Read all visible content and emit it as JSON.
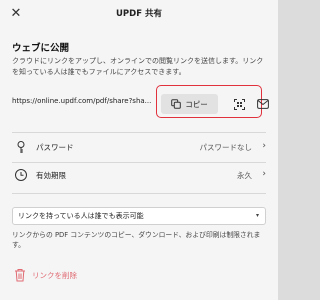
{
  "window": {
    "title": "UPDF 共有",
    "close_glyph": "✕"
  },
  "web_publish": {
    "heading": "ウェブに公開",
    "description": "クラウドにリンクをアップし、オンラインでの閲覧リンクを送信します。リンクを知っている人は誰でもファイルにアクセスできます。",
    "link_url": "https://online.updf.com/pdf/share?sha...",
    "copy_label": "コピー",
    "icons": {
      "copy": "copy-icon",
      "qr": "qr-code-icon",
      "mail": "mail-icon"
    },
    "highlight_color": "#e0313c"
  },
  "settings": {
    "password": {
      "label": "パスワード",
      "value": "パスワードなし",
      "icon": "key-icon"
    },
    "expiry": {
      "label": "有効期限",
      "value": "永久",
      "icon": "clock-icon"
    },
    "chevron": "›"
  },
  "access": {
    "selected": "リンクを持っている人は誰でも表示可能",
    "caret": "▾",
    "note": "リンクからの PDF コンテンツのコピー、ダウンロード、および印刷は制限されます。"
  },
  "delete": {
    "label": "リンクを削除",
    "icon": "trash-icon",
    "color": "#e06a72"
  }
}
